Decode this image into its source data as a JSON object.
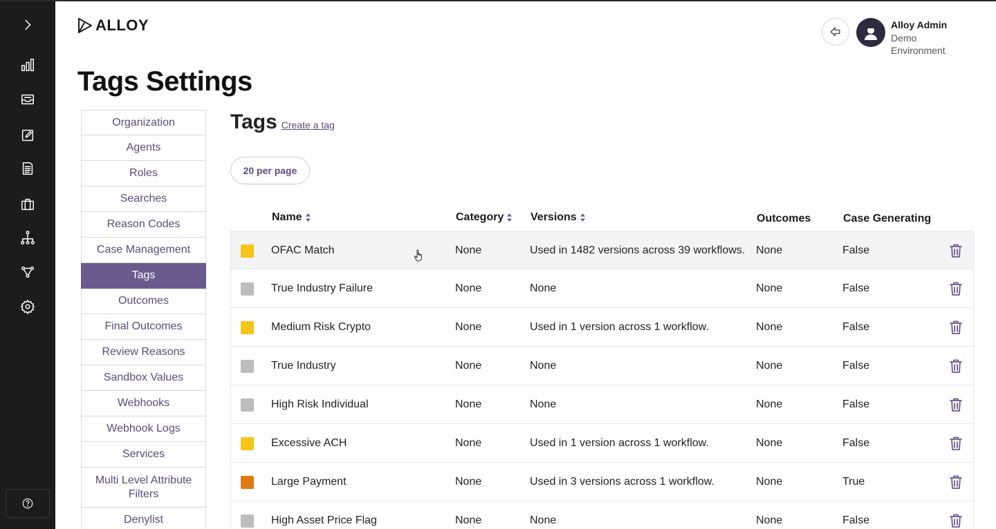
{
  "app": {
    "logo_text": "ALLOY"
  },
  "user": {
    "name": "Alloy Admin",
    "environment": "Demo Environment"
  },
  "page": {
    "title": "Tags Settings"
  },
  "rail": {
    "icons": [
      "chevron-right-icon",
      "bar-chart-icon",
      "inbox-icon",
      "edit-icon",
      "document-icon",
      "briefcase-icon",
      "hierarchy-icon",
      "workflow-icon",
      "gear-icon",
      "help-icon"
    ]
  },
  "nav": {
    "items": [
      {
        "label": "Organization"
      },
      {
        "label": "Agents"
      },
      {
        "label": "Roles"
      },
      {
        "label": "Searches"
      },
      {
        "label": "Reason Codes"
      },
      {
        "label": "Case Management"
      },
      {
        "label": "Tags",
        "active": true
      },
      {
        "label": "Outcomes"
      },
      {
        "label": "Final Outcomes"
      },
      {
        "label": "Review Reasons"
      },
      {
        "label": "Sandbox Values"
      },
      {
        "label": "Webhooks"
      },
      {
        "label": "Webhook Logs"
      },
      {
        "label": "Services"
      },
      {
        "label": "Multi Level Attribute Filters"
      },
      {
        "label": "Denylist"
      }
    ]
  },
  "tags": {
    "title": "Tags",
    "create_link": "Create a tag",
    "per_page": "20 per page",
    "columns": {
      "name": "Name",
      "category": "Category",
      "versions": "Versions",
      "outcomes": "Outcomes",
      "case_generating": "Case Generating"
    },
    "rows": [
      {
        "color": "#f5c518",
        "name": "OFAC Match",
        "category": "None",
        "versions": "Used in 1482 versions across 39 workflows.",
        "outcomes": "None",
        "case_generating": "False"
      },
      {
        "color": "#bdbdbd",
        "name": "True Industry Failure",
        "category": "None",
        "versions": "None",
        "outcomes": "None",
        "case_generating": "False"
      },
      {
        "color": "#f5c518",
        "name": "Medium Risk Crypto",
        "category": "None",
        "versions": "Used in 1 version across 1 workflow.",
        "outcomes": "None",
        "case_generating": "False"
      },
      {
        "color": "#bdbdbd",
        "name": "True Industry",
        "category": "None",
        "versions": "None",
        "outcomes": "None",
        "case_generating": "False"
      },
      {
        "color": "#bdbdbd",
        "name": "High Risk Individual",
        "category": "None",
        "versions": "None",
        "outcomes": "None",
        "case_generating": "False"
      },
      {
        "color": "#f5c518",
        "name": "Excessive ACH",
        "category": "None",
        "versions": "Used in 1 version across 1 workflow.",
        "outcomes": "None",
        "case_generating": "False"
      },
      {
        "color": "#e07a10",
        "name": "Large Payment",
        "category": "None",
        "versions": "Used in 3 versions across 1 workflow.",
        "outcomes": "None",
        "case_generating": "True"
      },
      {
        "color": "#bdbdbd",
        "name": "High Asset Price Flag",
        "category": "None",
        "versions": "None",
        "outcomes": "None",
        "case_generating": "False"
      }
    ]
  },
  "colors": {
    "accent": "#6b5a8e",
    "link": "#5c4a7d",
    "rail": "#1c1c1e"
  }
}
